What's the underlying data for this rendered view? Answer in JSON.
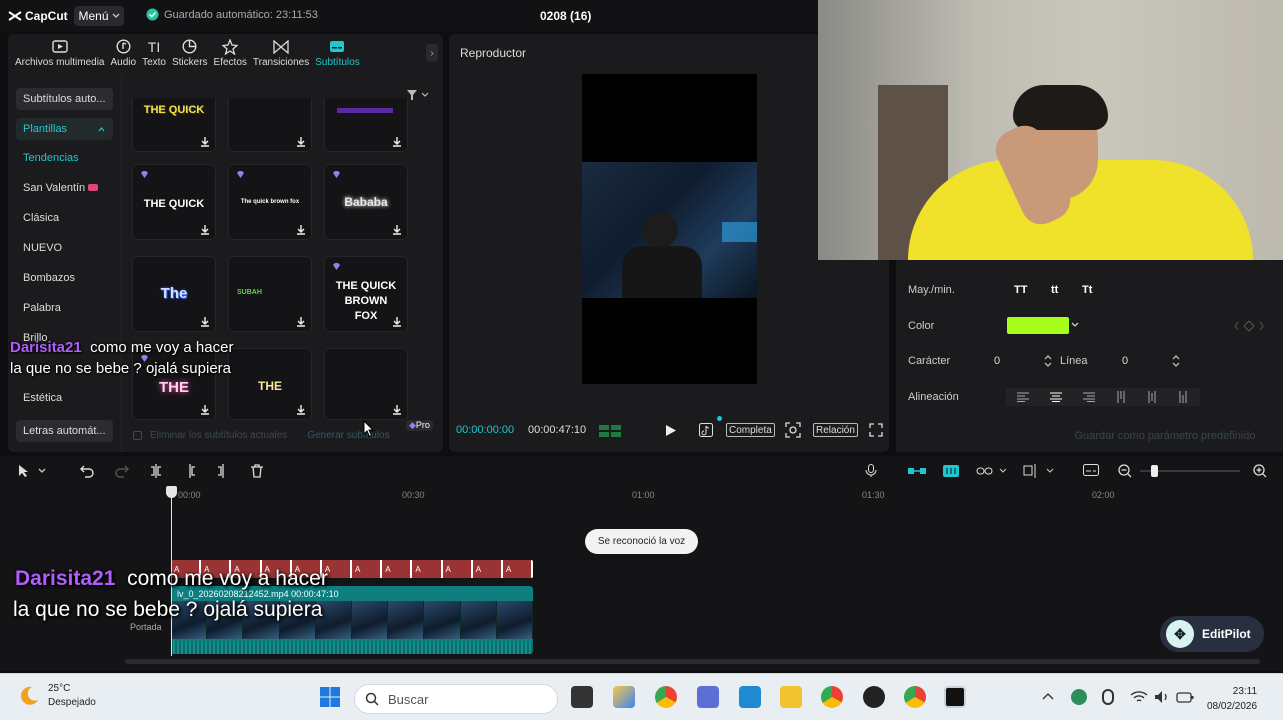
{
  "app": {
    "name": "CapCut",
    "menu_label": "Menú",
    "autosave": "Guardado automático: 23:11:53",
    "project_title": "0208 (16)"
  },
  "toolbar": {
    "tabs": [
      {
        "label": "Archivos multimedia",
        "icon": "media-icon"
      },
      {
        "label": "Audio",
        "icon": "audio-icon"
      },
      {
        "label": "Texto",
        "icon": "text-icon"
      },
      {
        "label": "Stickers",
        "icon": "sticker-icon"
      },
      {
        "label": "Efectos",
        "icon": "effects-icon"
      },
      {
        "label": "Transiciones",
        "icon": "transitions-icon"
      },
      {
        "label": "Subtítulos",
        "icon": "subtitles-icon",
        "active": true
      }
    ]
  },
  "sidebar": {
    "auto_subtitles": "Subtítulos auto...",
    "templates": "Plantillas",
    "items": [
      "Tendencias",
      "San Valentín",
      "Clásica",
      "NUEVO",
      "Bombazos",
      "Palabra",
      "Brillo",
      "Estética"
    ],
    "auto_lyrics": "Letras automát..."
  },
  "templates_grid": {
    "cards": [
      {
        "text": "THE QUICK"
      },
      {
        "text": ""
      },
      {
        "text": ""
      },
      {
        "text": "THE QUICK"
      },
      {
        "text": "The quick brown fox"
      },
      {
        "text": "Bababa"
      },
      {
        "text": "The"
      },
      {
        "text": "SUBAH"
      },
      {
        "text": "THE QUICK BROWN FOX"
      },
      {
        "text": "THE"
      },
      {
        "text": "THE"
      },
      {
        "text": ""
      }
    ],
    "pro_badge": "Pro",
    "remove_current": "Eliminar los subtítulos actuales",
    "generate": "Generar subtítulos"
  },
  "player": {
    "title": "Reproductor",
    "current_time": "00:00:00:00",
    "duration": "00:00:47:10",
    "full_label": "Completa",
    "ratio_label": "Relación"
  },
  "text_props": {
    "case_label": "May./min.",
    "case_options": [
      "TT",
      "tt",
      "Tt"
    ],
    "color_label": "Color",
    "color_value": "#a6ff1a",
    "char_label": "Carácter",
    "char_value": "0",
    "line_label": "Línea",
    "line_value": "0",
    "align_label": "Alineación",
    "save_default": "Guardar como parámetro predefinido"
  },
  "timeline": {
    "ruler": [
      "00:00",
      "00:30",
      "01:00",
      "01:30",
      "02:00"
    ],
    "toast": "Se reconoció la voz",
    "clip_name": "lv_0_20260208212452.mp4  00:00:47:10",
    "cover_label": "Portada",
    "caption_count": 12
  },
  "editpilot": {
    "label": "EditPilot"
  },
  "chat": {
    "user": "Darisita21",
    "line1": "como me voy a hacer",
    "line2": "la que no se bebe ? ojalá supiera"
  },
  "taskbar": {
    "temp": "25°C",
    "weather": "Despejado",
    "search_placeholder": "Buscar",
    "time": "23:11",
    "date": "08/02/2026"
  }
}
